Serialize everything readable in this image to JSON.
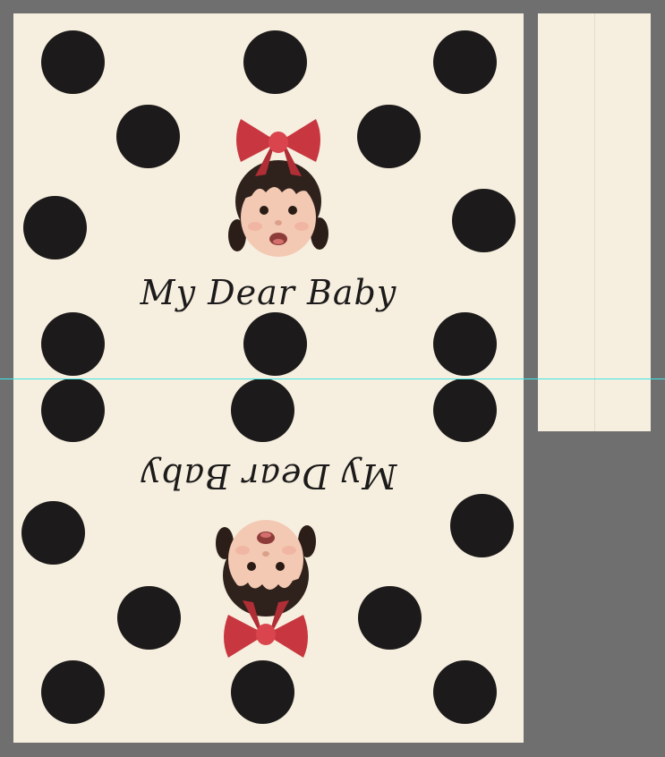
{
  "design": {
    "caption_text": "My Dear Baby"
  },
  "colors": {
    "canvas_background": "#6f6f6f",
    "paper": "#f6efdf",
    "dot": "#1c1a1a",
    "bow": "#c8373f",
    "guide": "#3ee6e6"
  },
  "icons": {
    "portrait": "baby-face-with-red-bow",
    "polka_dot": "black-circle"
  }
}
